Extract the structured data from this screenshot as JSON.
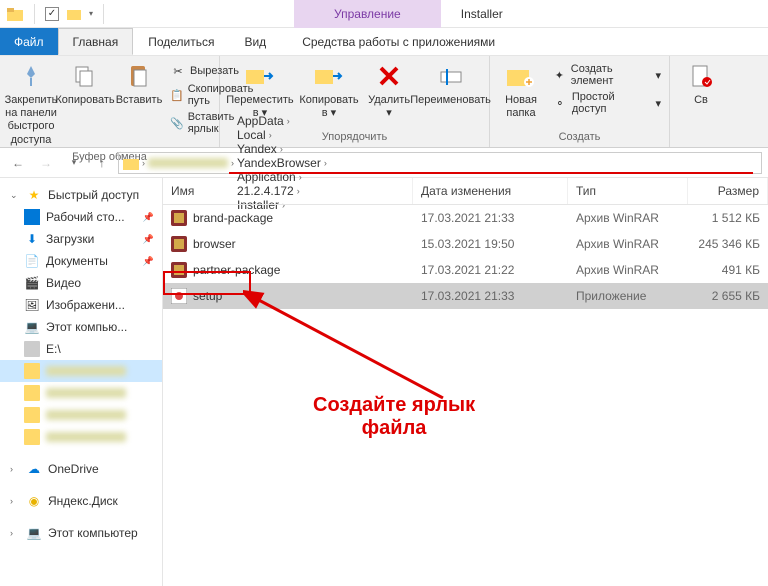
{
  "titlebar": {
    "context_tab": "Управление",
    "window_title": "Installer"
  },
  "tabs": {
    "file": "Файл",
    "home": "Главная",
    "share": "Поделиться",
    "view": "Вид",
    "tools": "Средства работы с приложениями"
  },
  "ribbon": {
    "pin": "Закрепить на панели\nбыстрого доступа",
    "copy": "Копировать",
    "paste": "Вставить",
    "cut": "Вырезать",
    "copypath": "Скопировать путь",
    "pasteshortcut": "Вставить ярлык",
    "clipboard_label": "Буфер обмена",
    "moveto": "Переместить в",
    "copyto": "Копировать в",
    "delete": "Удалить",
    "rename": "Переименовать",
    "organize_label": "Упорядочить",
    "newfolder": "Новая\nпапка",
    "newitem": "Создать элемент",
    "easyaccess": "Простой доступ",
    "create_label": "Создать",
    "properties": "Св"
  },
  "breadcrumbs": [
    "AppData",
    "Local",
    "Yandex",
    "YandexBrowser",
    "Application",
    "21.2.4.172",
    "Installer"
  ],
  "sidebar": {
    "quick": "Быстрый доступ",
    "desktop": "Рабочий сто...",
    "downloads": "Загрузки",
    "documents": "Документы",
    "videos": "Видео",
    "pictures": "Изображени...",
    "thispc_item": "Этот компью...",
    "drive_e": "E:\\",
    "onedrive": "OneDrive",
    "yandexdisk": "Яндекс.Диск",
    "thispc": "Этот компьютер"
  },
  "columns": {
    "name": "Имя",
    "date": "Дата изменения",
    "type": "Тип",
    "size": "Размер"
  },
  "files": [
    {
      "name": "brand-package",
      "date": "17.03.2021 21:33",
      "type": "Архив WinRAR",
      "size": "1 512 КБ",
      "icon": "archive"
    },
    {
      "name": "browser",
      "date": "15.03.2021 19:50",
      "type": "Архив WinRAR",
      "size": "245 346 КБ",
      "icon": "archive"
    },
    {
      "name": "partner-package",
      "date": "17.03.2021 21:22",
      "type": "Архив WinRAR",
      "size": "491 КБ",
      "icon": "archive"
    },
    {
      "name": "setup",
      "date": "17.03.2021 21:33",
      "type": "Приложение",
      "size": "2 655 КБ",
      "icon": "app",
      "selected": true
    }
  ],
  "annotation": "Создайте ярлык\nфайла"
}
